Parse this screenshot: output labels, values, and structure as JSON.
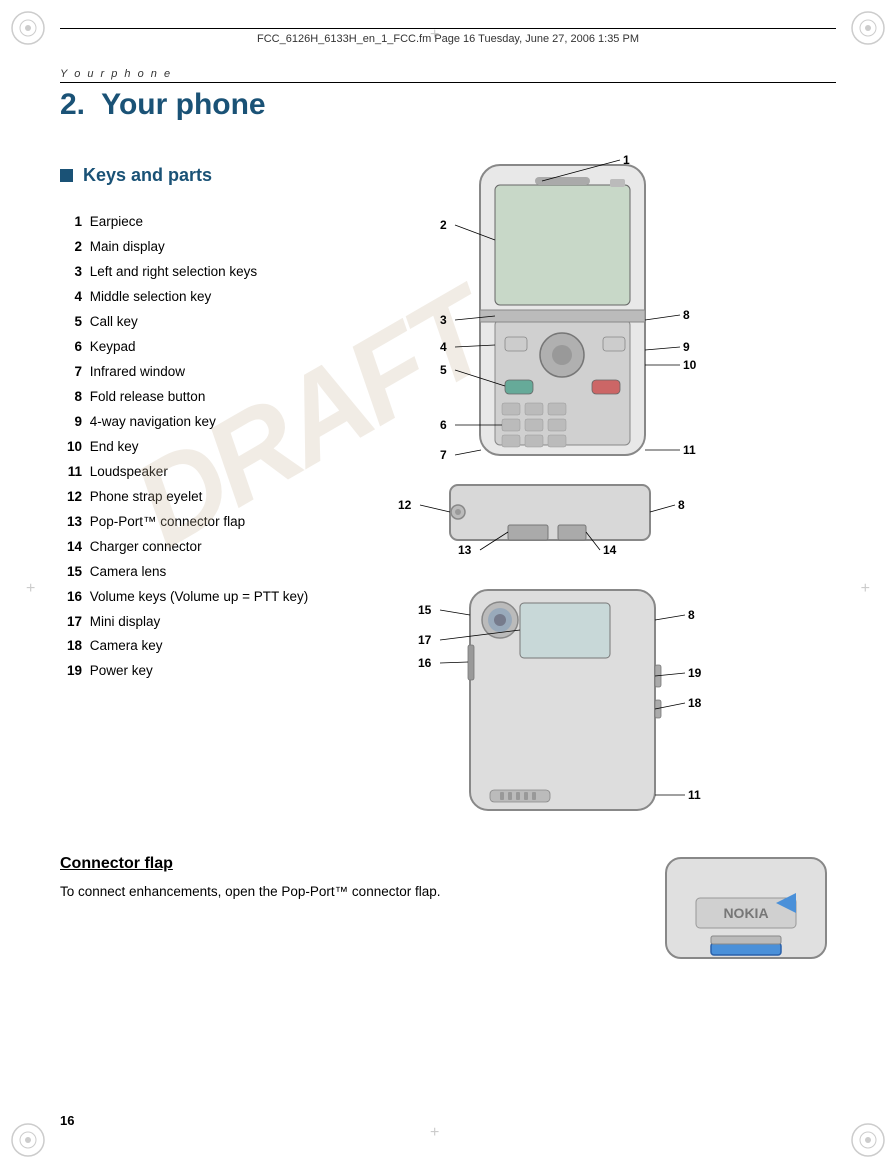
{
  "page": {
    "header_text": "FCC_6126H_6133H_en_1_FCC.fm  Page 16  Tuesday, June 27, 2006  1:35 PM",
    "section_label": "Y o u r   p h o n e",
    "chapter": "2.",
    "title": "Your phone",
    "keys_heading": "Keys and parts",
    "parts": [
      {
        "num": "1",
        "label": "Earpiece"
      },
      {
        "num": "2",
        "label": "Main display"
      },
      {
        "num": "3",
        "label": "Left and right selection keys"
      },
      {
        "num": "4",
        "label": "Middle selection key"
      },
      {
        "num": "5",
        "label": "Call key"
      },
      {
        "num": "6",
        "label": "Keypad"
      },
      {
        "num": "7",
        "label": "Infrared window"
      },
      {
        "num": "8",
        "label": "Fold release button"
      },
      {
        "num": "9",
        "label": "4-way navigation key"
      },
      {
        "num": "10",
        "label": "End key"
      },
      {
        "num": "11",
        "label": "Loudspeaker"
      },
      {
        "num": "12",
        "label": "Phone strap eyelet"
      },
      {
        "num": "13",
        "label": "Pop-Port™ connector flap"
      },
      {
        "num": "14",
        "label": "Charger connector"
      },
      {
        "num": "15",
        "label": "Camera lens"
      },
      {
        "num": "16",
        "label": "Volume keys (Volume up = PTT key)"
      },
      {
        "num": "17",
        "label": "Mini display"
      },
      {
        "num": "18",
        "label": "Camera key"
      },
      {
        "num": "19",
        "label": "Power key"
      }
    ],
    "connector_flap": {
      "title": "Connector flap",
      "text": "To connect enhancements, open the Pop-Port™ connector flap."
    },
    "page_number": "16",
    "draft_text": "DRAFT"
  }
}
